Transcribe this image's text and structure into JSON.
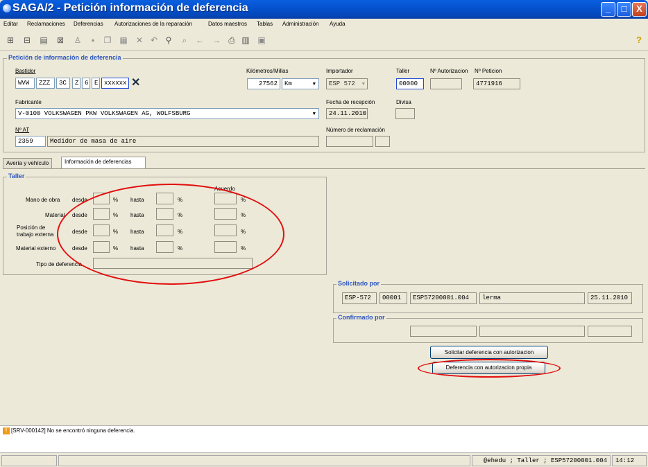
{
  "window": {
    "title": "SAGA/2 - Petición información de deferencia",
    "minimize_glyph": "_",
    "maximize_glyph": "□",
    "close_glyph": "X"
  },
  "menu": [
    "Editar",
    "Reclamaciones",
    "Deferencias",
    "Autorizaciones de la reparación",
    "Datos maestros",
    "Tablas",
    "Administración",
    "Ayuda"
  ],
  "toolbar": {
    "icons": [
      "tree-icon",
      "tree2-icon",
      "document-icon",
      "delete-icon",
      "users-icon",
      "save-icon",
      "copy-icon",
      "paste-icon",
      "close-icon",
      "undo-icon",
      "binoculars-icon",
      "search-icon",
      "back-arrow-icon",
      "forward-arrow-icon",
      "print-icon",
      "barcode-icon",
      "calculator-icon"
    ],
    "help_glyph": "?"
  },
  "header_group": {
    "legend": "Petición de información de deferencia",
    "bastidor_label": "Bastidor",
    "bastidor_parts": [
      "WVW",
      "ZZZ",
      "3C",
      "Z",
      "6",
      "E",
      "xxxxxx"
    ],
    "clear_glyph": "✕",
    "km_label": "Kilómetros/Millas",
    "km_value": "27562",
    "km_unit": "Km",
    "importador_label": "Importador",
    "importador_value": "ESP 572",
    "taller_label": "Taller",
    "taller_value": "00000",
    "autorizacion_label": "Nº Autorizacion",
    "autorizacion_value": "",
    "peticion_label": "Nº Peticion",
    "peticion_value": "4771916",
    "fabricante_label": "Fabricante",
    "fabricante_value": "V-0100 VOLKSWAGEN PKW VOLKSWAGEN AG, WOLFSBURG",
    "fecha_label": "Fecha de recepción",
    "fecha_value": "24.11.2010",
    "divisa_label": "Divisa",
    "divisa_value": "",
    "at_label": "Nº AT",
    "at_code": "2359",
    "at_desc": "Medidor de masa de aire",
    "reclamacion_label": "Número de reclamación"
  },
  "tabs": [
    "Avería y vehículo",
    "Información de deferencias"
  ],
  "taller_group": {
    "legend": "Taller",
    "acuerdo_label": "Acuerdo",
    "desde_label": "desde",
    "hasta_label": "hasta",
    "pct": "%",
    "rows": [
      "Mano de obra",
      "Material",
      "Posición de trabajo externa",
      "Material externo"
    ],
    "tipo_label": "Tipo de deferencia",
    "tipo_value": ""
  },
  "solicitado": {
    "legend": "Solicitado por",
    "importer": "ESP-572",
    "workshop": "00001",
    "user_id": "ESP57200001.004",
    "name": "lerma",
    "date": "25.11.2010"
  },
  "confirmado": {
    "legend": "Confirmado por"
  },
  "buttons": {
    "solicitar": "Solicitar deferencia con autorizacion",
    "propia": "Deferencia con autorizacion propia"
  },
  "message": {
    "icon": "warning-icon",
    "text": "[SRV-000142] No se encontró ninguna deferencia."
  },
  "statusbar": {
    "session": "@ehedu ; Taller ; ESP57200001.004",
    "time": "14:12"
  },
  "annotation_color": "#e20f0f",
  "title_bar_color": "#0553cf",
  "legend_color": "#2b55c1"
}
